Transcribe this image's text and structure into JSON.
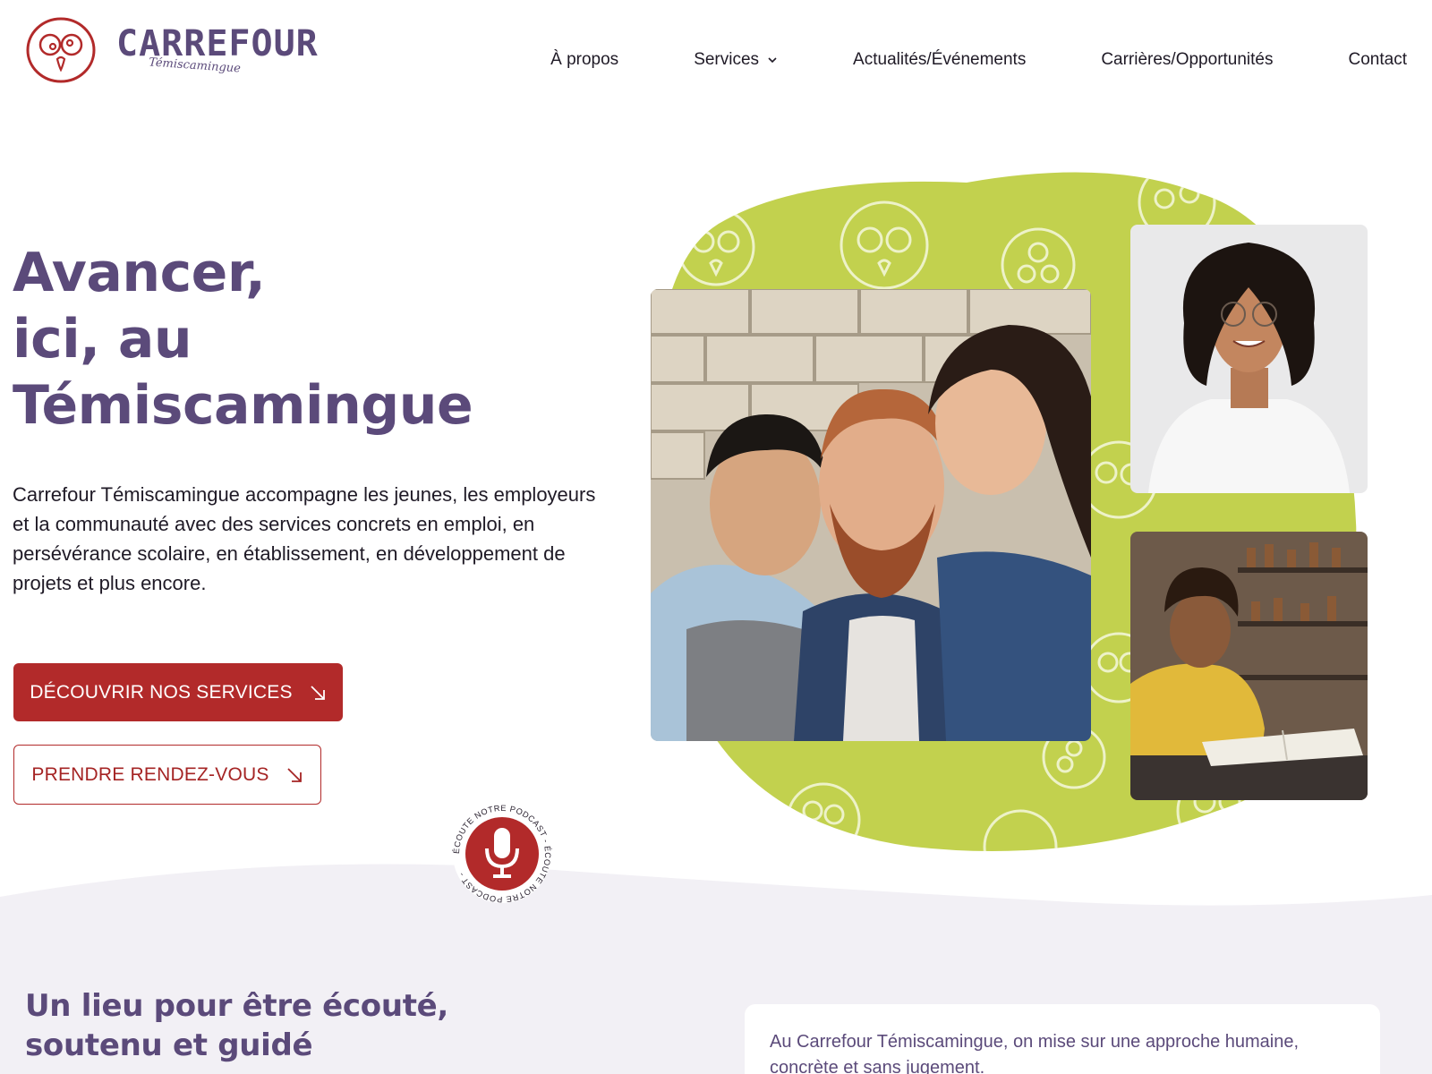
{
  "brand": {
    "name": "CARREFOUR",
    "subtitle": "Témiscamingue",
    "colors": {
      "purple": "#5b4a7a",
      "red": "#b22a2a",
      "lime": "#c2d14e",
      "lavender": "#f2f0f5"
    }
  },
  "nav": {
    "items": [
      {
        "label": "À propos"
      },
      {
        "label": "Services",
        "has_dropdown": true
      },
      {
        "label": "Actualités/Événements"
      },
      {
        "label": "Carrières/Opportunités"
      },
      {
        "label": "Contact"
      }
    ]
  },
  "hero": {
    "title_lines": [
      "Avancer,",
      "ici, au",
      "Témiscamingue"
    ],
    "description": "Carrefour Témiscamingue accompagne les jeunes, les employeurs et la communauté avec des services concrets en emploi, en persévérance scolaire, en établissement, en développement de projets et plus encore.",
    "primary_button": "DÉCOUVRIR NOS SERVICES",
    "secondary_button": "PRENDRE RENDEZ-VOUS"
  },
  "podcast": {
    "ring_text": "ÉCOUTE NOTRE PODCAST - ÉCOUTE NOTRE PODCAST - ",
    "icon": "microphone-icon"
  },
  "section": {
    "title_lines": [
      "Un lieu pour être écouté,",
      "soutenu et guidé"
    ],
    "quote": "Au Carrefour Témiscamingue, on mise sur une approche humaine, concrète et sans jugement."
  }
}
